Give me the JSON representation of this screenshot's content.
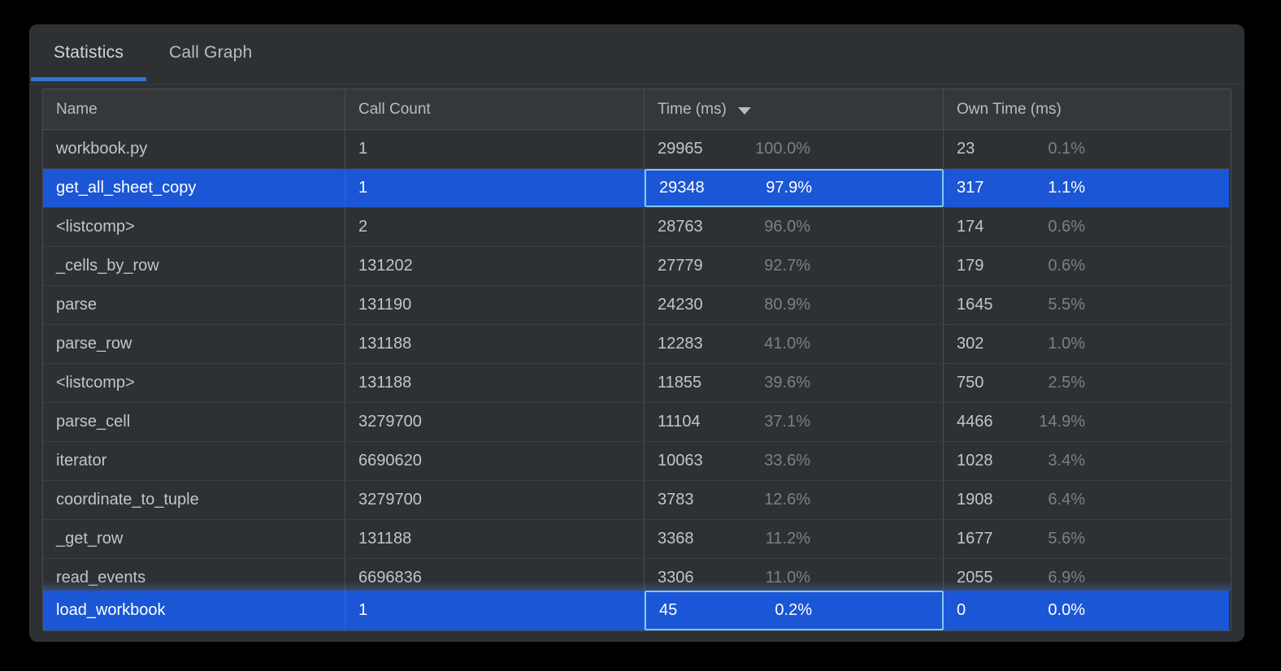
{
  "tabs": [
    {
      "label": "Statistics",
      "active": true
    },
    {
      "label": "Call Graph",
      "active": false
    }
  ],
  "table": {
    "columns": [
      {
        "label": "Name",
        "sorted": false
      },
      {
        "label": "Call Count",
        "sorted": false
      },
      {
        "label": "Time (ms)",
        "sorted": true,
        "sort_direction": "descending",
        "sort_icon": "caret-down-icon"
      },
      {
        "label": "Own Time (ms)",
        "sorted": false
      }
    ],
    "rows": [
      {
        "name": "workbook.py",
        "call_count": "1",
        "time": "29965",
        "time_pct": "100.0%",
        "own_time": "23",
        "own_pct": "0.1%",
        "selected": false
      },
      {
        "name": "get_all_sheet_copy",
        "call_count": "1",
        "time": "29348",
        "time_pct": "97.9%",
        "own_time": "317",
        "own_pct": "1.1%",
        "selected": true
      },
      {
        "name": "<listcomp>",
        "call_count": "2",
        "time": "28763",
        "time_pct": "96.0%",
        "own_time": "174",
        "own_pct": "0.6%",
        "selected": false
      },
      {
        "name": "_cells_by_row",
        "call_count": "131202",
        "time": "27779",
        "time_pct": "92.7%",
        "own_time": "179",
        "own_pct": "0.6%",
        "selected": false
      },
      {
        "name": "parse",
        "call_count": "131190",
        "time": "24230",
        "time_pct": "80.9%",
        "own_time": "1645",
        "own_pct": "5.5%",
        "selected": false
      },
      {
        "name": "parse_row",
        "call_count": "131188",
        "time": "12283",
        "time_pct": "41.0%",
        "own_time": "302",
        "own_pct": "1.0%",
        "selected": false
      },
      {
        "name": "<listcomp>",
        "call_count": "131188",
        "time": "11855",
        "time_pct": "39.6%",
        "own_time": "750",
        "own_pct": "2.5%",
        "selected": false
      },
      {
        "name": "parse_cell",
        "call_count": "3279700",
        "time": "11104",
        "time_pct": "37.1%",
        "own_time": "4466",
        "own_pct": "14.9%",
        "selected": false
      },
      {
        "name": "iterator",
        "call_count": "6690620",
        "time": "10063",
        "time_pct": "33.6%",
        "own_time": "1028",
        "own_pct": "3.4%",
        "selected": false
      },
      {
        "name": "coordinate_to_tuple",
        "call_count": "3279700",
        "time": "3783",
        "time_pct": "12.6%",
        "own_time": "1908",
        "own_pct": "6.4%",
        "selected": false
      },
      {
        "name": "_get_row",
        "call_count": "131188",
        "time": "3368",
        "time_pct": "11.2%",
        "own_time": "1677",
        "own_pct": "5.6%",
        "selected": false
      },
      {
        "name": "read_events",
        "call_count": "6696836",
        "time": "3306",
        "time_pct": "11.0%",
        "own_time": "2055",
        "own_pct": "6.9%",
        "selected": false
      }
    ],
    "pinned_row": {
      "name": "load_workbook",
      "call_count": "1",
      "time": "45",
      "time_pct": "0.2%",
      "own_time": "0",
      "own_pct": "0.0%",
      "selected": true
    }
  },
  "colors": {
    "page_background": "#000000",
    "panel_background": "#2e3133",
    "header_background": "#35383a",
    "selection_blue": "#1a56d6",
    "tab_underline_blue": "#2a7ad0",
    "focus_outline": "#7ec8f0",
    "text_primary": "#c2c5c7",
    "text_muted": "#7c8082",
    "grid_line": "#4a4d50"
  }
}
